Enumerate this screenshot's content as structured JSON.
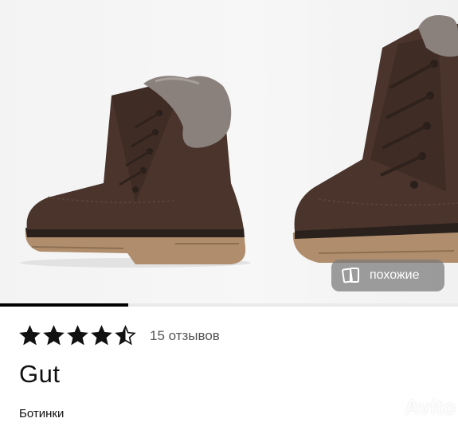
{
  "gallery": {
    "progress_fraction": 0.28,
    "similar_button": {
      "label": "похожие",
      "icon": "similar-photos-icon"
    }
  },
  "product": {
    "rating": 4.5,
    "reviews_label": "15 отзывов",
    "brand": "Gut",
    "category": "Ботинки"
  },
  "watermark": {
    "text": "Avito"
  },
  "colors": {
    "boot_leather": "#4a342c",
    "sole_tan": "#b08e6d",
    "fur": "#8a817c",
    "star": "#111111",
    "overlay_button": "#7a7a7a"
  }
}
